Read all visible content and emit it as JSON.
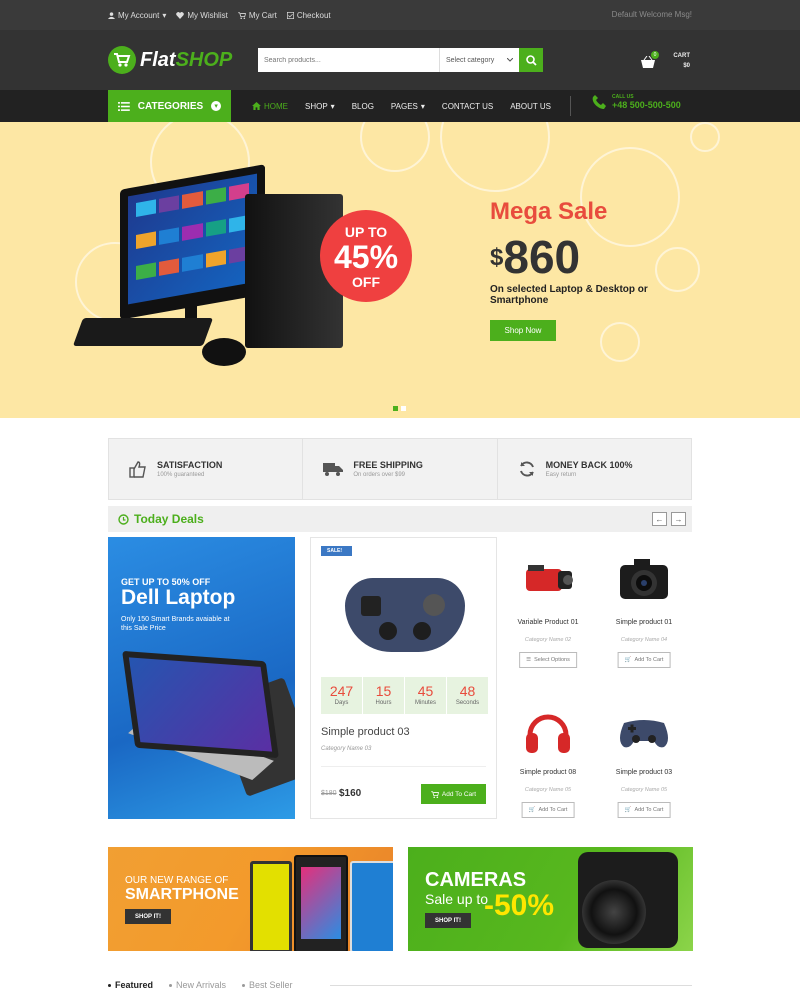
{
  "topbar": {
    "links": [
      {
        "label": "My Account",
        "icon": "user-icon",
        "caret": "▾"
      },
      {
        "label": "My Wishlist",
        "icon": "heart-icon"
      },
      {
        "label": "My Cart",
        "icon": "cart-icon"
      },
      {
        "label": "Checkout",
        "icon": "checkout-icon"
      }
    ],
    "welcome": "Default Welcome Msg!"
  },
  "header": {
    "logo_flat": "Flat",
    "logo_shop": "SHOP",
    "search_placeholder": "Search products...",
    "category_select": "Select category",
    "cart_count": "0",
    "cart_label": "CART",
    "cart_total": "$0"
  },
  "nav": {
    "categories_label": "CATEGORIES",
    "menu": [
      {
        "label": "HOME",
        "active": true,
        "icon": "home-icon"
      },
      {
        "label": "SHOP",
        "caret": "▾"
      },
      {
        "label": "BLOG"
      },
      {
        "label": "PAGES",
        "caret": "▾"
      },
      {
        "label": "CONTACT US"
      },
      {
        "label": "ABOUT US"
      }
    ],
    "call_us_label": "CALL US",
    "phone": "+48 500-500-500"
  },
  "hero": {
    "badge_line1": "UP TO",
    "badge_line2": "45%",
    "badge_line3": "OFF",
    "title": "Mega Sale",
    "currency": "$",
    "price": "860",
    "description": "On selected Laptop & Desktop or Smartphone",
    "button": "Shop Now"
  },
  "features": [
    {
      "title": "SATISFACTION",
      "subtitle": "100% guaranteed",
      "icon": "thumbs-up-icon"
    },
    {
      "title": "FREE SHIPPING",
      "subtitle": "On orders over $99",
      "icon": "truck-icon"
    },
    {
      "title": "MONEY BACK 100%",
      "subtitle": "Easy return",
      "icon": "refresh-icon"
    }
  ],
  "deals": {
    "title": "Today Deals",
    "prev": "←",
    "next": "→",
    "promo": {
      "line1": "GET UP TO 50% OFF",
      "line2": "Dell Laptop",
      "line3": "Only 150 Smart Brands avaiable at this Sale Price"
    },
    "featured": {
      "badge": "SALE!",
      "countdown": [
        {
          "value": "247",
          "unit": "Days"
        },
        {
          "value": "15",
          "unit": "Hours"
        },
        {
          "value": "45",
          "unit": "Minutes"
        },
        {
          "value": "48",
          "unit": "Seconds"
        }
      ],
      "name": "Simple product 03",
      "category": "Category Name 03",
      "old_price": "$180",
      "price": "$160",
      "button": "Add To Cart"
    },
    "products": [
      {
        "name": "Variable Product 01",
        "category": "Category Name 02",
        "button": "Select Options",
        "image": "camcorder"
      },
      {
        "name": "Simple product 01",
        "category": "Category Name 04",
        "button": "Add To Cart",
        "image": "dslr-camera"
      },
      {
        "name": "Simple product 08",
        "category": "Category Name 05",
        "button": "Add To Cart",
        "image": "headphones"
      },
      {
        "name": "Simple product 03",
        "category": "Category Name 05",
        "button": "Add To Cart",
        "image": "gamepad"
      }
    ]
  },
  "banners": {
    "smartphone": {
      "line1": "OUR NEW RANGE OF",
      "line2": "SMARTPHONE",
      "button": "SHOP IT!"
    },
    "cameras": {
      "line1": "CAMERAS",
      "line2": "Sale up to",
      "line3": "-50%",
      "button": "SHOP IT!"
    }
  },
  "product_tabs": [
    {
      "label": "Featured",
      "active": true
    },
    {
      "label": "New Arrivals",
      "active": false
    },
    {
      "label": "Best Seller",
      "active": false
    }
  ],
  "colors": {
    "brand_green": "#4caf1c",
    "sale_red": "#e84c3d",
    "hero_bg": "#fde7a4",
    "dark_header": "#333333"
  }
}
